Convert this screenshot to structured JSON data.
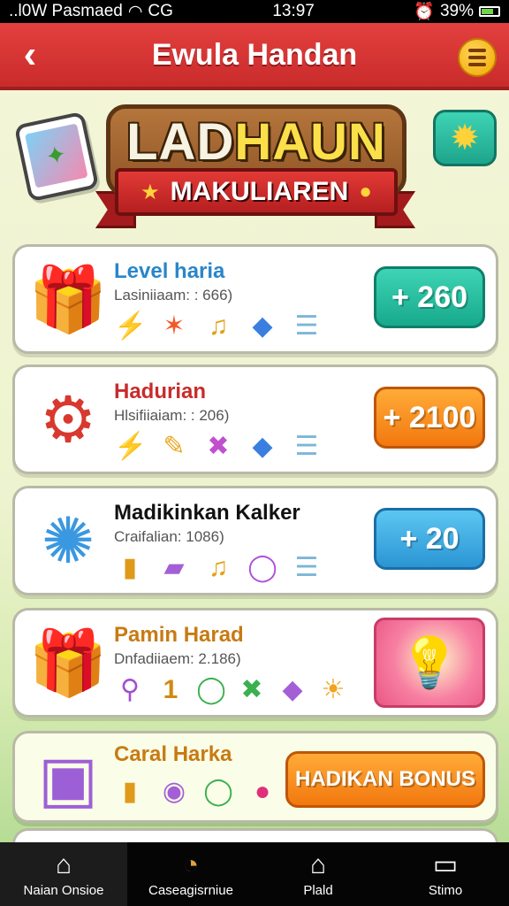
{
  "status_bar": {
    "carrier": "..l0W Pasmaed",
    "network": "CG",
    "time": "13:97",
    "battery": "39%",
    "icons": [
      "wifi-icon",
      "alarm-icon",
      "battery-icon"
    ]
  },
  "header": {
    "title": "Ewula Handan",
    "back_icon": "back-chevron-icon",
    "menu_icon": "menu-icon"
  },
  "banner": {
    "logo_part1": "LAD",
    "logo_part2": "HAUN",
    "ribbon_text": "MAKULIAREN"
  },
  "cards": [
    {
      "title": "Level haria",
      "title_color": "#2a86c9",
      "subtitle": "Lasiniiaam: : 666)",
      "icon": "gift-box-green-icon",
      "items": [
        "lightning-icon",
        "star-icon",
        "music-note-icon",
        "gem-icon",
        "coin-stack-icon"
      ],
      "reward": "+ 260",
      "reward_style": "teal"
    },
    {
      "title": "Hadurian",
      "title_color": "#c92b2b",
      "subtitle": "Hlsifiiaiam: : 206)",
      "icon": "red-machine-icon",
      "items": [
        "lightning-icon",
        "pencil-icon",
        "cross-icon",
        "gem-arrow-icon",
        "coin-stack-icon"
      ],
      "reward": "+ 2100",
      "reward_style": "orange"
    },
    {
      "title": "Madikinkan Kalker",
      "title_color": "#111111",
      "subtitle": "Craifalian: 1086)",
      "icon": "gear-badge-icon",
      "items": [
        "jar-icon",
        "card-icon",
        "music-note-icon",
        "ring-icon",
        "coin-stack-icon"
      ],
      "reward": "+ 20",
      "reward_style": "blue"
    },
    {
      "title": "Pamin Harad",
      "title_color": "#c87a12",
      "subtitle": "Dnfadiiaem: 2.186)",
      "icon": "gift-box-red-icon",
      "items": [
        "wand-icon",
        "number-one-icon",
        "ring-icon",
        "cross-icon",
        "cube-icon",
        "sun-icon"
      ],
      "item_text": [
        "",
        "1",
        "",
        "",
        "",
        ""
      ],
      "reward_icon": "lightbulb-icon"
    },
    {
      "title": "Caral Harka",
      "title_color": "#c87a12",
      "subtitle": "",
      "icon": "purple-box-icon",
      "items": [
        "jar-icon",
        "candy-icon",
        "ring-icon",
        "berry-icon"
      ],
      "bonus_label": "HADIKAN BONUS"
    }
  ],
  "tabs": [
    {
      "label": "Naian Onsioe",
      "icon": "home-icon",
      "active": true
    },
    {
      "label": "Caseagisrniue",
      "icon": "clock-icon",
      "active": false
    },
    {
      "label": "Plald",
      "icon": "house-outline-icon",
      "active": false
    },
    {
      "label": "Stimo",
      "icon": "monitor-icon",
      "active": false
    }
  ]
}
